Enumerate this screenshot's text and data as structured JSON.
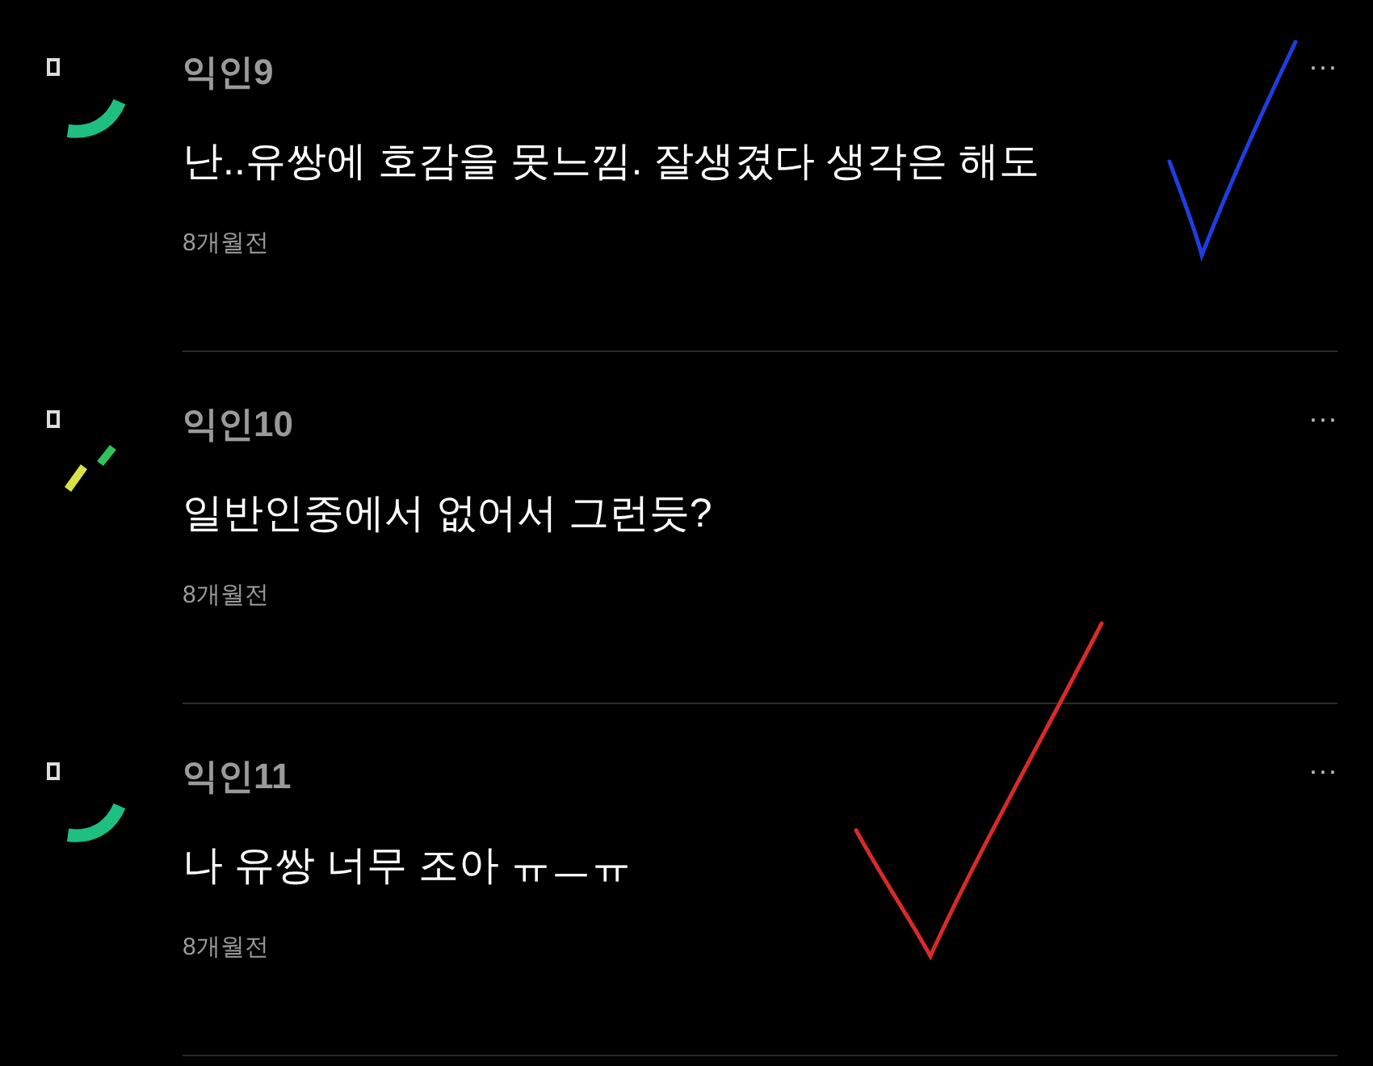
{
  "comments": [
    {
      "author": "익인9",
      "text": "난..유쌍에 호감을 못느낌. 잘생겼다 생각은 해도",
      "time": "8개월전",
      "avatar": {
        "kind": "smile"
      },
      "more": "···",
      "check": {
        "color": "#1f3ee0"
      }
    },
    {
      "author": "익인10",
      "text": "일반인중에서 없어서 그런듯?",
      "time": "8개월전",
      "avatar": {
        "kind": "slashes"
      },
      "more": "···"
    },
    {
      "author": "익인11",
      "text": "나 유쌍 너무 조아 ㅠㅡㅠ",
      "time": "8개월전",
      "avatar": {
        "kind": "smile"
      },
      "more": "···",
      "check": {
        "color": "#d82a2a"
      }
    }
  ]
}
